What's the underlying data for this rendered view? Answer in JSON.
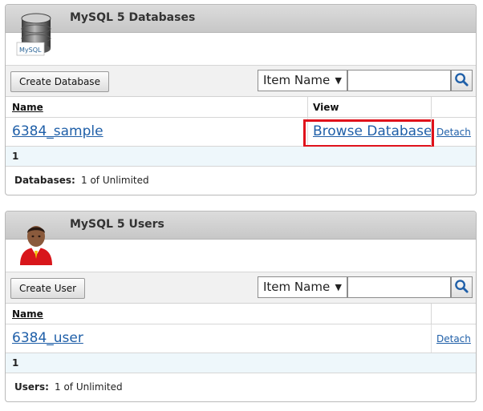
{
  "databases_panel": {
    "title": "MySQL 5 Databases",
    "icon": "mysql-database-icon",
    "icon_text": "MySQL",
    "create_button": "Create Database",
    "filter_select": "Item Name",
    "search_value": "",
    "columns": {
      "name": "Name",
      "view": "View"
    },
    "rows": [
      {
        "name": "6384_sample",
        "view": "Browse Database",
        "action": "Detach"
      }
    ],
    "page": "1",
    "summary_label": "Databases:",
    "summary_value": "1 of Unlimited"
  },
  "users_panel": {
    "title": "MySQL 5 Users",
    "icon": "user-avatar-icon",
    "create_button": "Create User",
    "filter_select": "Item Name",
    "search_value": "",
    "columns": {
      "name": "Name"
    },
    "rows": [
      {
        "name": "6384_user",
        "action": "Detach"
      }
    ],
    "page": "1",
    "summary_label": "Users:",
    "summary_value": "1 of Unlimited"
  },
  "colors": {
    "link": "#1f5fa8",
    "highlight": "#e0121b",
    "pager_bg": "#eef7fb"
  }
}
